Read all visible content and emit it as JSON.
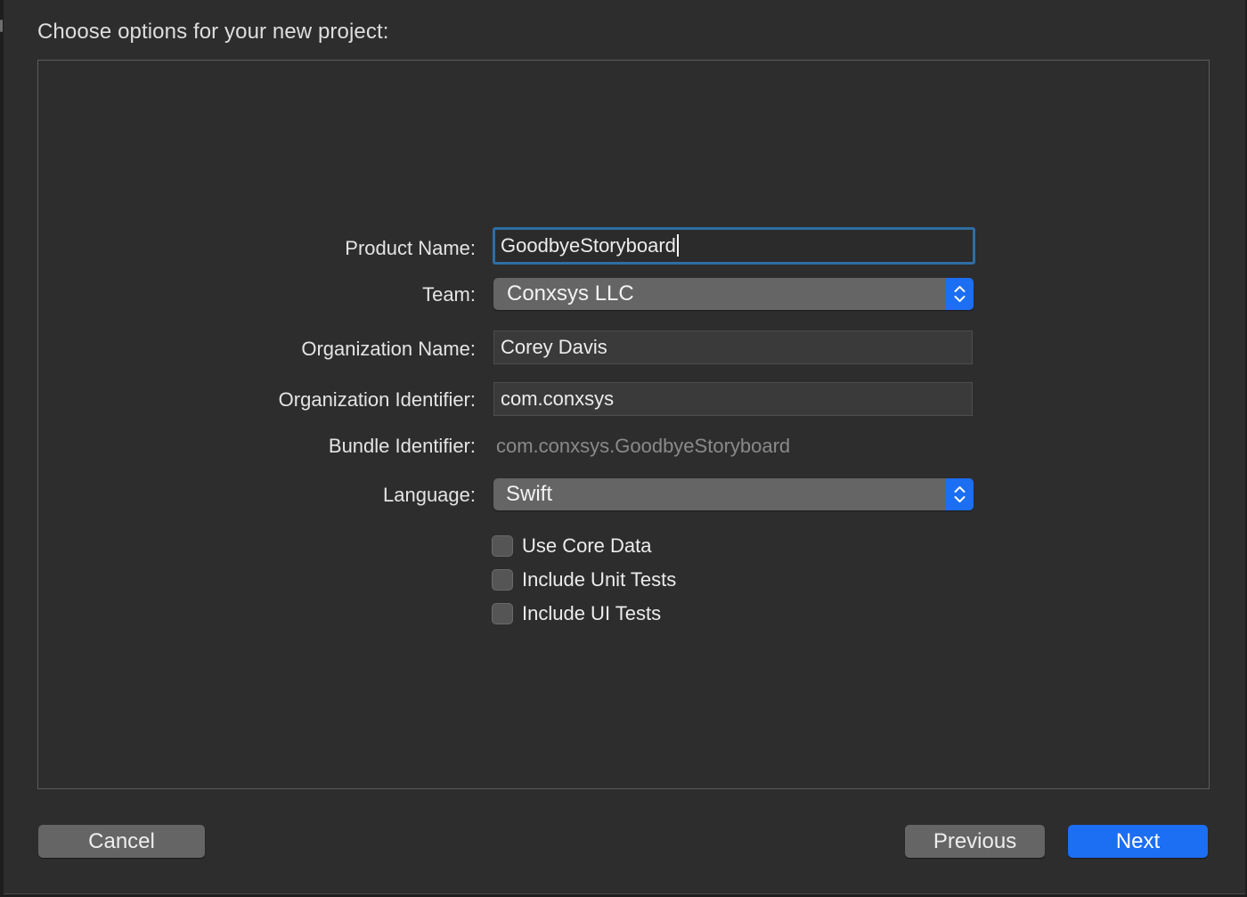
{
  "sheet": {
    "title": "Choose options for your new project:"
  },
  "form": {
    "product_name": {
      "label": "Product Name:",
      "value": "GoodbyeStoryboard"
    },
    "team": {
      "label": "Team:",
      "selected": "Conxsys LLC"
    },
    "organization_name": {
      "label": "Organization Name:",
      "value": "Corey Davis"
    },
    "organization_identifier": {
      "label": "Organization Identifier:",
      "value": "com.conxsys"
    },
    "bundle_identifier": {
      "label": "Bundle Identifier:",
      "value": "com.conxsys.GoodbyeStoryboard"
    },
    "language": {
      "label": "Language:",
      "selected": "Swift"
    },
    "checkboxes": [
      {
        "label": "Use Core Data",
        "checked": false
      },
      {
        "label": "Include Unit Tests",
        "checked": false
      },
      {
        "label": "Include UI Tests",
        "checked": false
      }
    ]
  },
  "footer": {
    "cancel_label": "Cancel",
    "previous_label": "Previous",
    "next_label": "Next"
  },
  "colors": {
    "accent": "#1c6ef2",
    "focus_ring": "#2f6da3",
    "background": "#2d2d2d"
  },
  "icons": {
    "popup_arrows": "chevron-up-down-icon"
  }
}
